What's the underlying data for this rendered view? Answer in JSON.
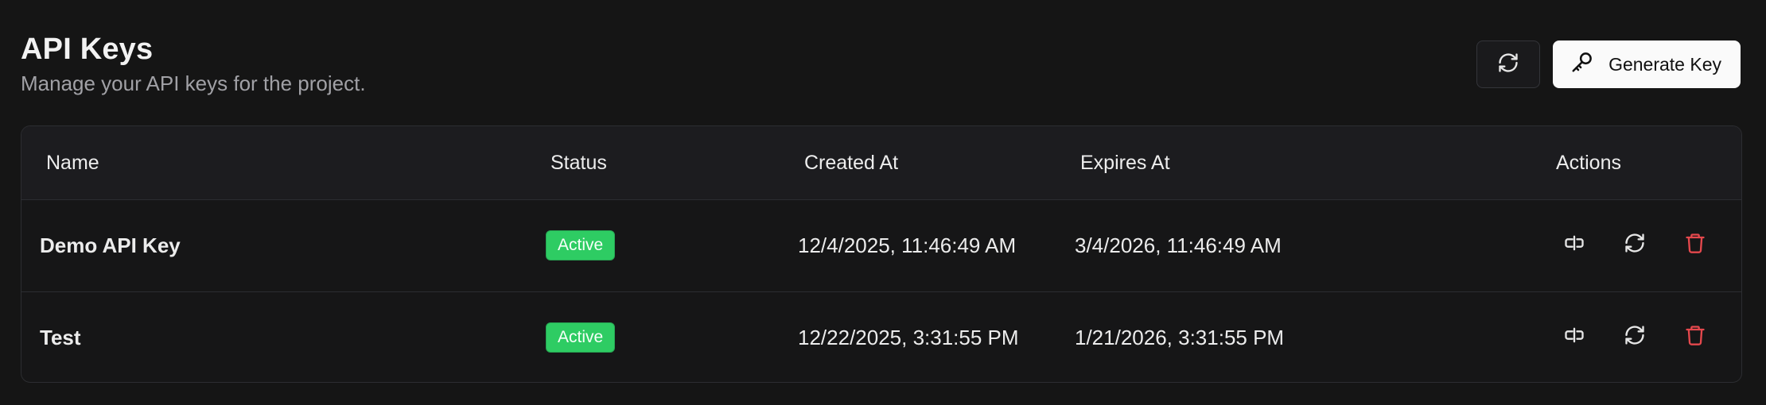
{
  "header": {
    "title": "API Keys",
    "subtitle": "Manage your API keys for the project."
  },
  "toolbar": {
    "refresh_icon": "refresh-icon",
    "generate_label": "Generate Key",
    "generate_icon": "key-icon"
  },
  "table": {
    "columns": [
      "Name",
      "Status",
      "Created At",
      "Expires At",
      "Actions"
    ],
    "rows": [
      {
        "name": "Demo API Key",
        "status": "Active",
        "created_at": "12/4/2025, 11:46:49 AM",
        "expires_at": "3/4/2026, 11:46:49 AM",
        "actions": [
          "toggle-icon",
          "rotate-icon",
          "trash-icon"
        ]
      },
      {
        "name": "Test",
        "status": "Active",
        "created_at": "12/22/2025, 3:31:55 PM",
        "expires_at": "1/21/2026, 3:31:55 PM",
        "actions": [
          "toggle-icon",
          "rotate-icon",
          "trash-icon"
        ]
      }
    ]
  },
  "colors": {
    "background": "#151515",
    "active_badge": "#2ecc63",
    "delete": "#e5484d"
  }
}
